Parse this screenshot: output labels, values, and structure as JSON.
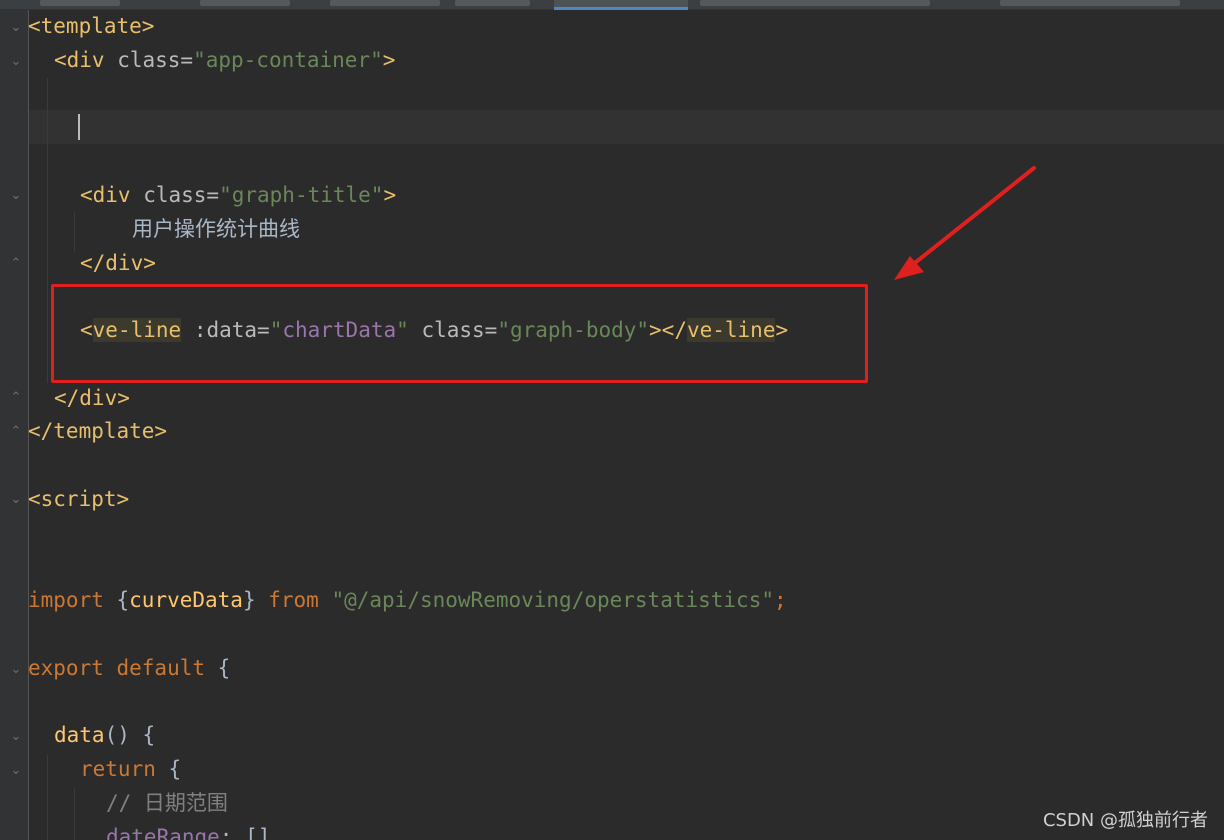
{
  "code": {
    "l1": "<template>",
    "l2_tag_open": "<div",
    "l2_attr": " class=",
    "l2_str": "\"app-container\"",
    "l2_close": ">",
    "l5_tag_open": "<div",
    "l5_attr": " class=",
    "l5_str": "\"graph-title\"",
    "l5_close": ">",
    "l6_text": "用户操作统计曲线",
    "l7": "</div>",
    "l9_lt": "<",
    "l9_tag": "ve-line",
    "l9_attr1": " :data=",
    "l9_str1_q1": "\"",
    "l9_str1_val": "chartData",
    "l9_str1_q2": "\"",
    "l9_attr2": " class=",
    "l9_str2": "\"graph-body\"",
    "l9_mid": "></",
    "l9_tag2": "ve-line",
    "l9_gt": ">",
    "l11": "</div>",
    "l12": "</template>",
    "l14": "<script>",
    "l17_import": "import",
    "l17_brace_open": " {",
    "l17_name": "curveData",
    "l17_brace_close": "} ",
    "l17_from": "from",
    "l17_path": " \"@/api/snowRemoving/operstatistics\"",
    "l17_semi": ";",
    "l19_export": "export",
    "l19_default": " default",
    "l19_brace": " {",
    "l21_data": "data",
    "l21_rest": "() {",
    "l22_return": "return",
    "l22_brace": " {",
    "l23_comment": "// 日期范围",
    "l24_key": "dateRange",
    "l24_rest": ": []"
  },
  "watermark": "CSDN @孤独前行者",
  "colors": {
    "background": "#2b2b2b",
    "tag": "#e8bf6a",
    "string": "#6a8759",
    "keyword": "#cc7832",
    "annotation_red": "#e0201f"
  }
}
